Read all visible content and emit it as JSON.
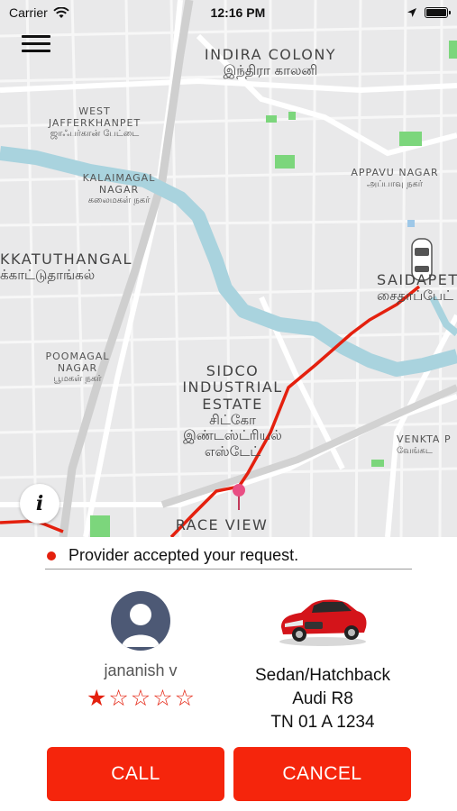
{
  "status_bar": {
    "carrier": "Carrier",
    "time": "12:16 PM"
  },
  "map": {
    "labels": [
      {
        "en": "INDIRA COLONY",
        "ta": "இந்திரா காலனி"
      },
      {
        "en": "WEST JAFFERKHANPET",
        "ta": "ஜாஃபர்கான் பேட்டை"
      },
      {
        "en": "KALAIMAGAL NAGAR",
        "ta": "கலைமகள் நகர்"
      },
      {
        "en": "APPAVU NAGAR",
        "ta": "அப்பாவு நகர்"
      },
      {
        "en": "KKATUTHANGAL",
        "ta": "க்காட்டுதாங்கல்"
      },
      {
        "en": "SAIDAPET",
        "ta": "சைதாப்பேட்"
      },
      {
        "en": "POOMAGAL NAGAR",
        "ta": "பூமகள் நகர்"
      },
      {
        "en": "SIDCO INDUSTRIAL ESTATE",
        "ta": "சிட்கோ இண்டஸ்ட்ரியல் எஸ்டேட்"
      },
      {
        "en": "VENKTA P",
        "ta": "வேங்கட"
      },
      {
        "en": "RACE VIEW",
        "ta": ""
      }
    ]
  },
  "panel": {
    "status_message": "Provider accepted your request.",
    "provider": {
      "name": "jananish v",
      "rating": 1,
      "max_rating": 5
    },
    "vehicle": {
      "type": "Sedan/Hatchback",
      "model": "Audi R8",
      "plate": "TN 01 A 1234"
    },
    "call_label": "CALL",
    "cancel_label": "CANCEL"
  },
  "colors": {
    "accent": "#f5250c",
    "route": "#e4200e",
    "avatar": "#4d5975"
  }
}
